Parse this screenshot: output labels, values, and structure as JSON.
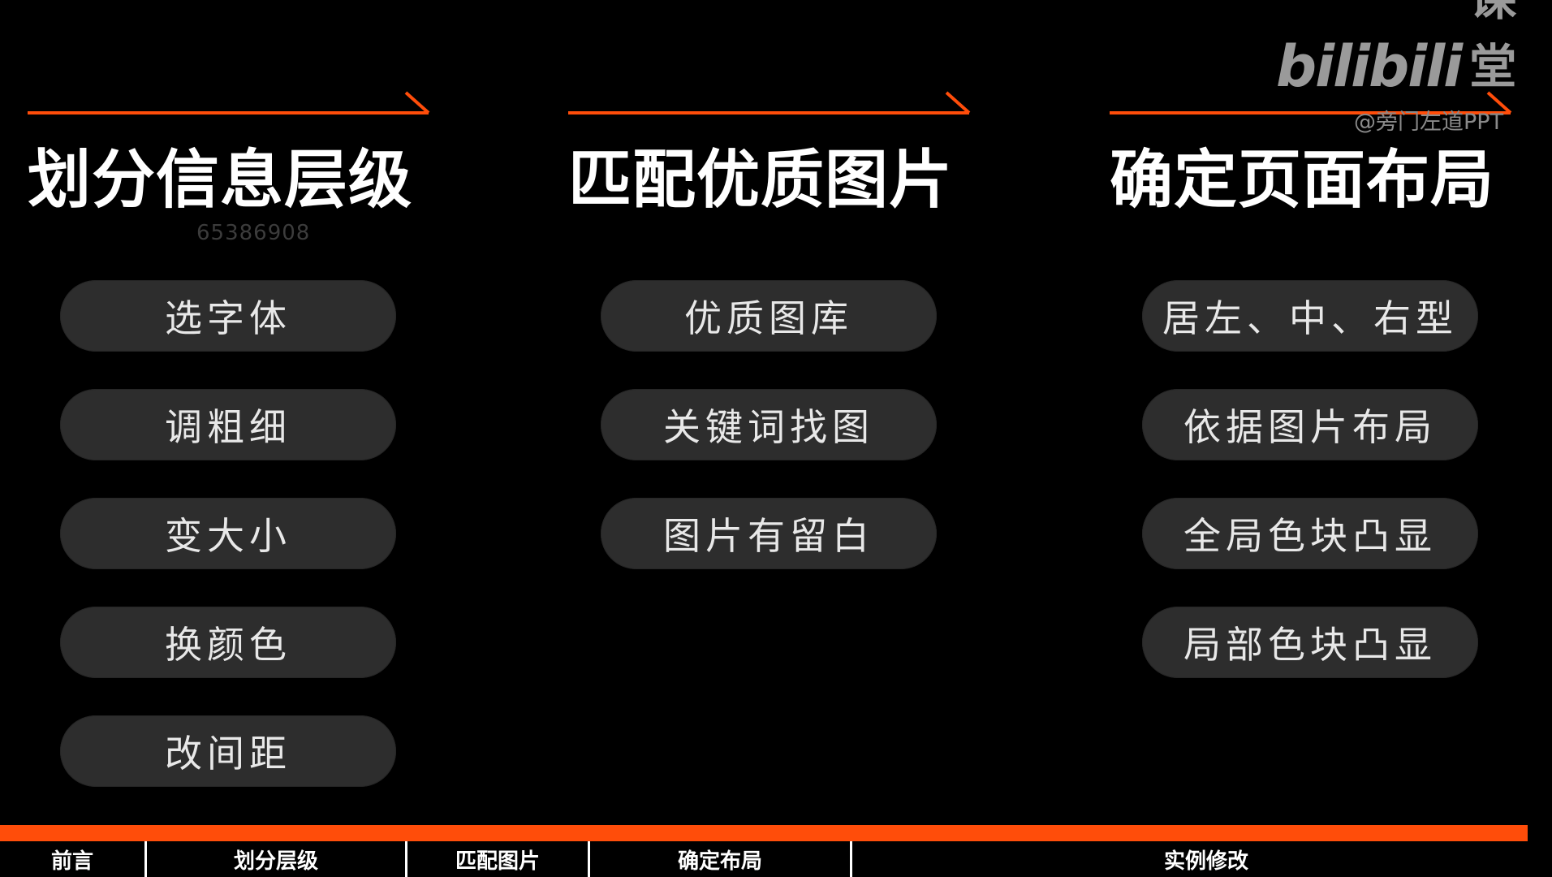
{
  "colors": {
    "accent": "#ff4d0a",
    "background": "#000000",
    "pill_background": "#2d2d2d",
    "text": "#ffffff"
  },
  "columns": [
    {
      "title": "划分信息层级",
      "items": [
        "选字体",
        "调粗细",
        "变大小",
        "换颜色",
        "改间距"
      ]
    },
    {
      "title": "匹配优质图片",
      "items": [
        "优质图库",
        "关键词找图",
        "图片有留白"
      ]
    },
    {
      "title": "确定页面布局",
      "items": [
        "居左、中、右型",
        "依据图片布局",
        "全局色块凸显",
        "局部色块凸显"
      ]
    }
  ],
  "watermark": {
    "logo": "bilibili",
    "logo_suffix": "课堂",
    "handle": "@旁门左道PPT",
    "number": "65386908"
  },
  "nav": {
    "items": [
      "前言",
      "划分层级",
      "匹配图片",
      "确定布局",
      "实例修改"
    ],
    "progress_color": "#ff4d0a"
  }
}
